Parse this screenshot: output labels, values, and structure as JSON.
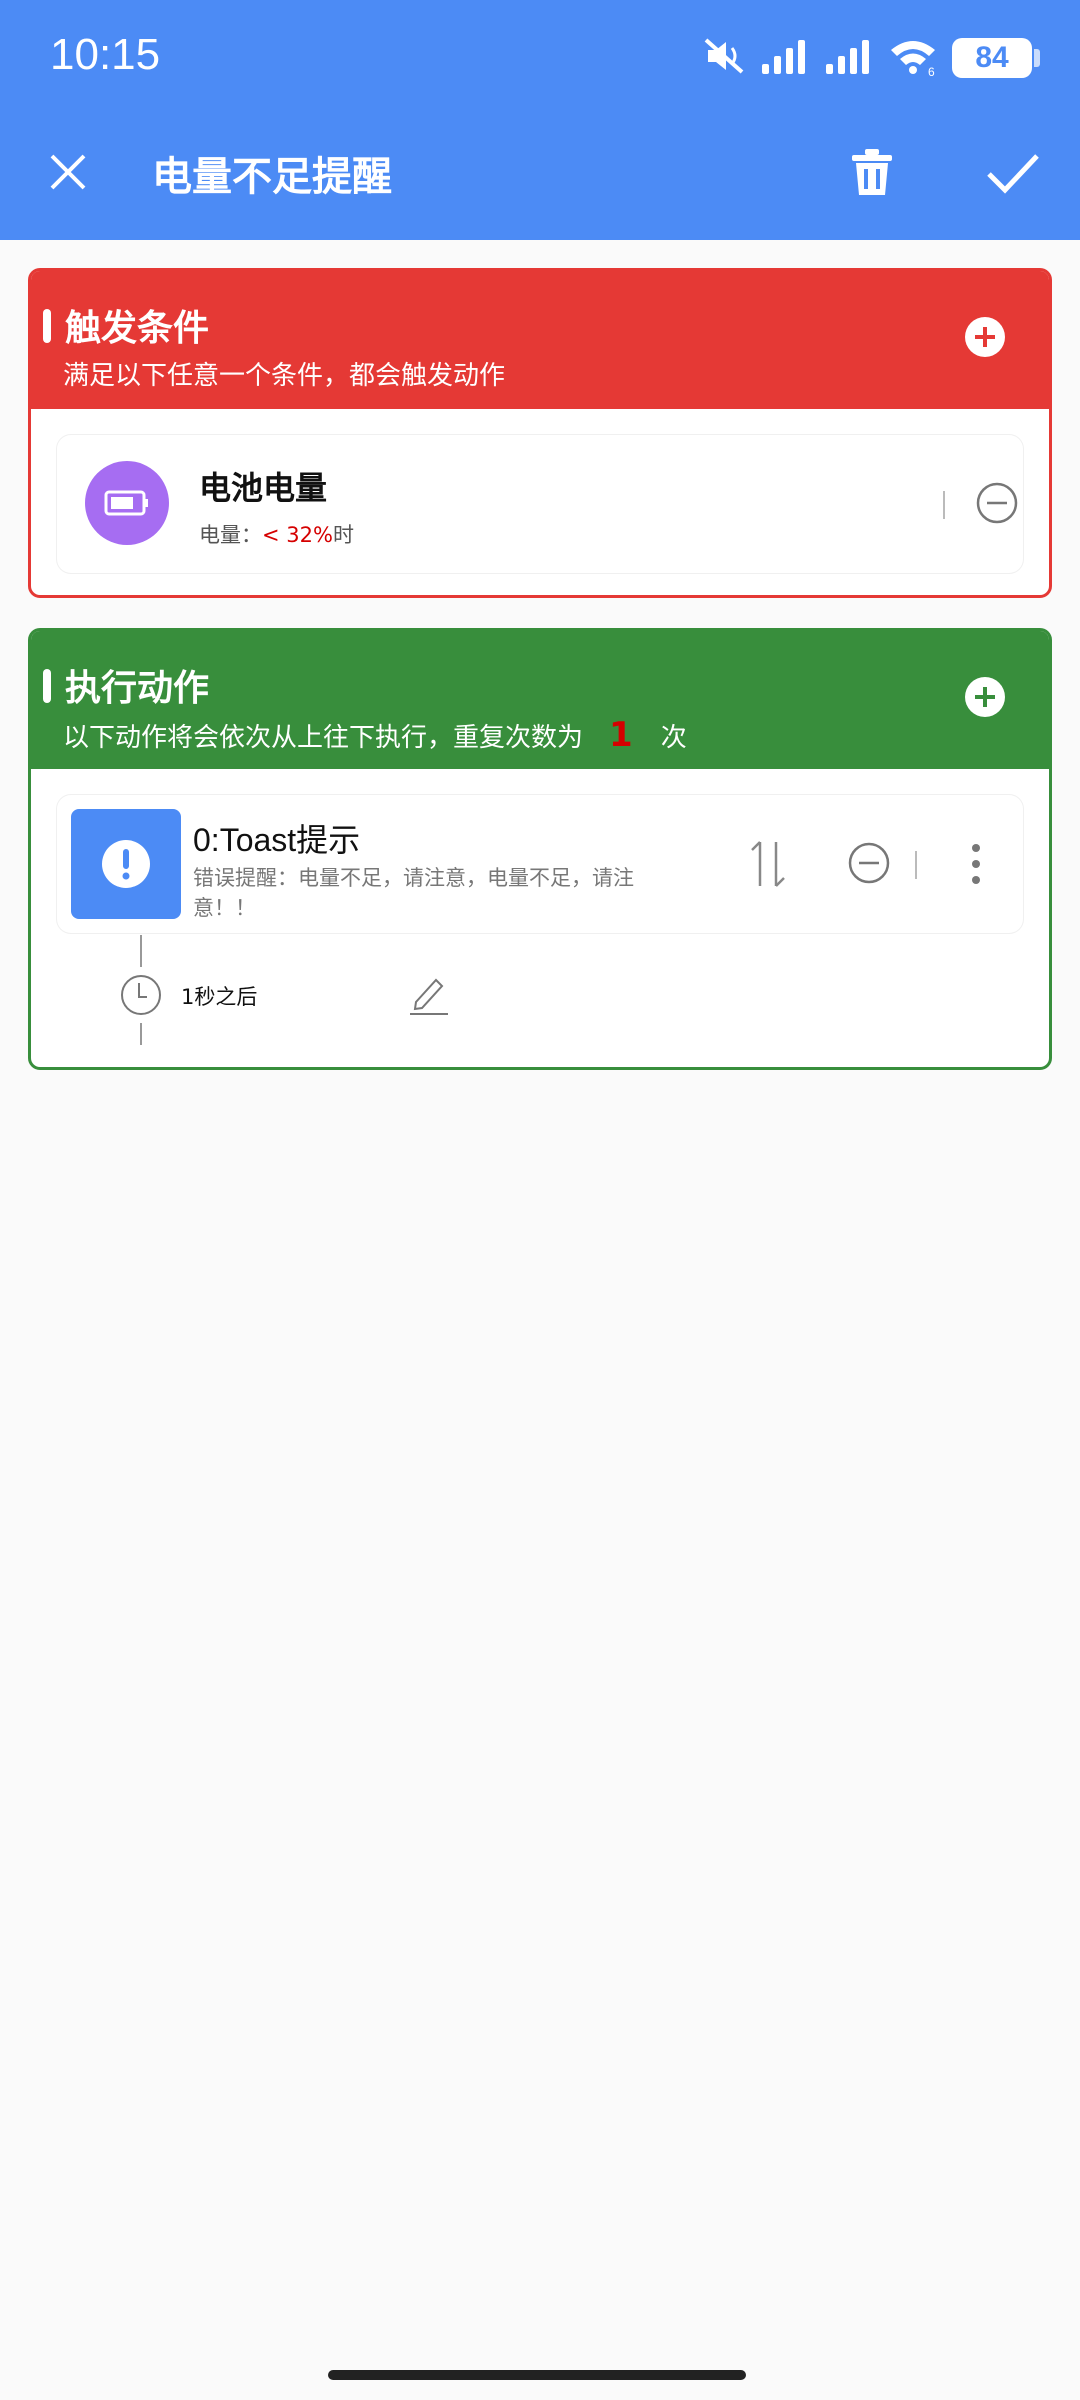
{
  "status_bar": {
    "time": "10:15",
    "battery_level": "84",
    "icons": [
      "mute-icon",
      "signal-icon",
      "signal-icon",
      "wifi-icon",
      "battery-icon"
    ]
  },
  "app_bar": {
    "title": "电量不足提醒",
    "close_icon": "close-icon",
    "delete_icon": "trash-icon",
    "confirm_icon": "check-icon",
    "background_color": "#4c8bf5"
  },
  "trigger_section": {
    "title": "触发条件",
    "description": "满足以下任意一个条件，都会触发动作",
    "color": "#e53935",
    "items": [
      {
        "title": "电池电量",
        "sub_prefix": "电量：",
        "sub_value": "< 32%",
        "sub_suffix": "时",
        "icon": "battery-icon",
        "icon_color": "#a66df2"
      }
    ]
  },
  "action_section": {
    "title": "执行动作",
    "description_prefix": "以下动作将会依次从上往下执行，重复次数为",
    "repeat_count": "1",
    "description_suffix": "次",
    "color": "#388e3c",
    "items": [
      {
        "title": "0:Toast提示",
        "subtitle": "错误提醒：电量不足，请注意，电量不足，请注意！！",
        "icon": "exclamation-icon",
        "icon_color": "#4c8bf5"
      }
    ],
    "delay": {
      "text": "1秒之后"
    }
  }
}
